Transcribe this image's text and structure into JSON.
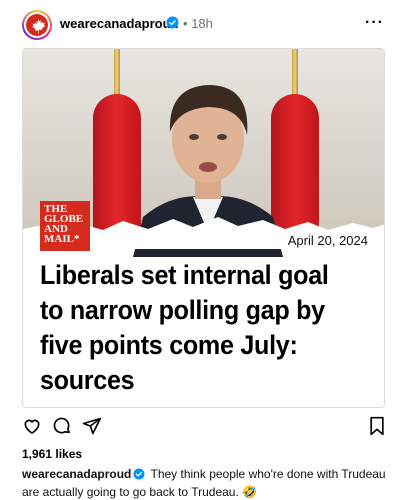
{
  "header": {
    "username": "wearecanadaproud",
    "separator": "•",
    "time": "18h",
    "more": "···"
  },
  "post": {
    "logo_text": "THE GLOBE AND MAIL*",
    "date": "April 20, 2024",
    "headline": "Liberals set internal goal to narrow polling gap by five points come July: sources"
  },
  "engagement": {
    "likes": "1,961 likes"
  },
  "caption": {
    "username": "wearecanadaproud",
    "text": "They think people who're done with Trudeau are actually going to go back to Trudeau. 🤣"
  },
  "colors": {
    "brand_red": "#d52b1e",
    "verified_blue": "#0095f6",
    "muted": "#737373"
  }
}
